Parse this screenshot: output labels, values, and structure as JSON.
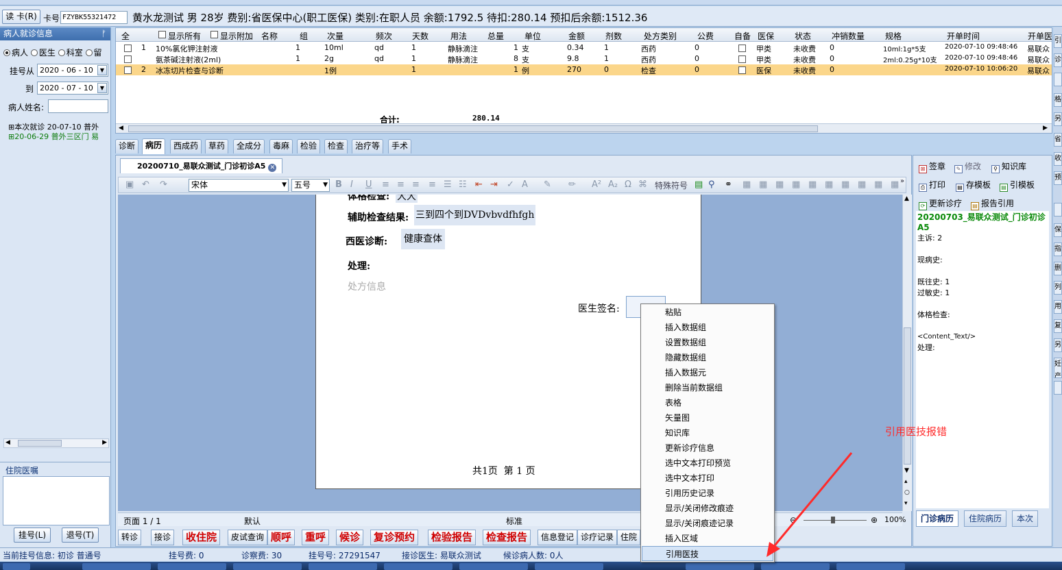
{
  "patient_bar": {
    "read_card_label": "读 卡(R)",
    "card_label": "卡号:",
    "card_value": "FZYBK55321472",
    "info": "黄水龙测试 男 28岁 费别:省医保中心(职工医保) 类别:在职人员 余额:1792.5 待扣:280.14 预扣后余额:1512.36"
  },
  "left_panel": {
    "header": "病人就诊信息",
    "radio_patient": "病人",
    "radio_doctor": "医生",
    "radio_dept": "科室",
    "radio_stay": "留",
    "from_label": "挂号从",
    "from_date": "2020 - 06 - 10",
    "to_label": "到",
    "to_date": "2020 - 07 - 10",
    "name_label": "病人姓名:",
    "tree_items": [
      "本次就诊 20-07-10 普外",
      "20-06-29 普外三区门 易"
    ],
    "inpatient_header": "住院医嘱",
    "register_btn": "挂号(L)",
    "unregister_btn": "退号(T)"
  },
  "grid": {
    "headers": [
      "全",
      "显示所有",
      "显示附加",
      "名称",
      "组",
      "次量",
      "频次",
      "天数",
      "用法",
      "总量",
      "单位",
      "金额",
      "剂数",
      "处方类别",
      "公费",
      "自备",
      "医保",
      "状态",
      "冲销数量",
      "规格",
      "开单时间",
      "开单医"
    ],
    "rows": [
      {
        "no": "1",
        "name": "10%氯化钾注射液",
        "group": "1",
        "dose": "10ml",
        "freq": "qd",
        "days": "1",
        "usage": "静脉滴注",
        "total": "1",
        "unit": "支",
        "amount": "0.34",
        "doses": "1",
        "category": "西药",
        "public": "0",
        "insurance": "甲类",
        "status": "未收费",
        "offset": "0",
        "spec": "10ml:1g*5支",
        "time": "2020-07-10 09:48:46",
        "doctor": "易联众"
      },
      {
        "no": "",
        "name": "氨茶碱注射液(2ml)",
        "group": "1",
        "dose": "2g",
        "freq": "qd",
        "days": "1",
        "usage": "静脉滴注",
        "total": "8",
        "unit": "支",
        "amount": "9.8",
        "doses": "1",
        "category": "西药",
        "public": "0",
        "insurance": "甲类",
        "status": "未收费",
        "offset": "0",
        "spec": "2ml:0.25g*10支",
        "time": "2020-07-10 09:48:46",
        "doctor": "易联众"
      },
      {
        "no": "2",
        "name": "冰冻切片检查与诊断",
        "group": "",
        "dose": "1例",
        "freq": "",
        "days": "1",
        "usage": "",
        "total": "1",
        "unit": "例",
        "amount": "270",
        "doses": "0",
        "category": "检查",
        "public": "0",
        "insurance": "医保",
        "status": "未收费",
        "offset": "0",
        "spec": "",
        "time": "2020-07-10 10:06:20",
        "doctor": "易联众"
      }
    ],
    "total_label": "合计:",
    "total_value": "280.14"
  },
  "tabs": [
    "诊断",
    "病历",
    "西成药",
    "草药",
    "全成分",
    "毒麻",
    "检验",
    "检查",
    "治疗等",
    "手术"
  ],
  "doc": {
    "tab_title": "20200710_易联众测试_门诊初诊A5",
    "font_name": "宋体",
    "font_size": "五号",
    "special_char": "特殊符号",
    "cut_label": "体格检查:",
    "cut_value": "大大",
    "aux_label": "辅助检查结果:",
    "aux_value": "三到四个到DVDvbvdfhfgh",
    "diag_label": "西医诊断:",
    "diag_value": "健康查体",
    "treat_label": "处理:",
    "rx_placeholder": "处方信息",
    "sign_label": "医生签名:",
    "page_footer": "共1页  第 1 页",
    "status_page": "页面 1 / 1",
    "status_default": "默认",
    "status_std": "标准",
    "zoom": "100%"
  },
  "right_panel": {
    "sign": "签章",
    "modify": "修改",
    "knowledge": "知识库",
    "print": "打印",
    "save_tpl": "存模板",
    "ref_tpl": "引模板",
    "update_diag": "更新诊疗",
    "report_ref": "报告引用",
    "record_title": "20200703_易联众测试_门诊初诊A5",
    "lines": [
      "主诉: 2",
      "",
      "现病史:",
      "",
      "既往史: 1",
      "过敏史: 1",
      "",
      "体格检查:",
      "",
      "<Content_Text/>",
      "处理:"
    ],
    "tab_outpatient": "门诊病历",
    "tab_inpatient": "住院病历",
    "tab_this": "本次"
  },
  "far_right": [
    "引",
    "诊",
    "",
    "格",
    "另",
    "省",
    "收",
    "预",
    "",
    "保",
    "指",
    "删",
    "列",
    "用",
    "复",
    "另",
    "妊产",
    ""
  ],
  "action_bar": {
    "transfer": "转诊",
    "receive": "接诊",
    "admit": "收住院",
    "skin_test": "皮试查询",
    "seq_call": "顺呼",
    "recall": "重呼",
    "wait": "候诊",
    "followup": "复诊预约",
    "lab_report": "检验报告",
    "exam_report": "检查报告",
    "info_reg": "信息登记",
    "records": "诊疗记录",
    "inpatient": "住院"
  },
  "status_bar": {
    "reg_info": "当前挂号信息:  初诊 普通号",
    "reg_fee": "挂号费:  0",
    "diag_fee": "诊察费:  30",
    "reg_no": "挂号号:  27291547",
    "doctor": "接诊医生:  易联众测试",
    "waiting": "候诊病人数: 0人"
  },
  "context_menu": [
    "粘贴",
    "插入数据组",
    "设置数据组",
    "隐藏数据组",
    "插入数据元",
    "删除当前数据组",
    "表格",
    "矢量图",
    "知识库",
    "更新诊疗信息",
    "选中文本打印预览",
    "选中文本打印",
    "引用历史记录",
    "显示/关闭修改痕迹",
    "显示/关闭痕迹记录",
    "插入区域",
    "引用医技"
  ],
  "annotation": "引用医技报错",
  "colors": {
    "accent": "#3e6fae",
    "highlight_row": "#fbd68a",
    "annotation": "#ff2a2a",
    "action_red": "#d00000"
  }
}
